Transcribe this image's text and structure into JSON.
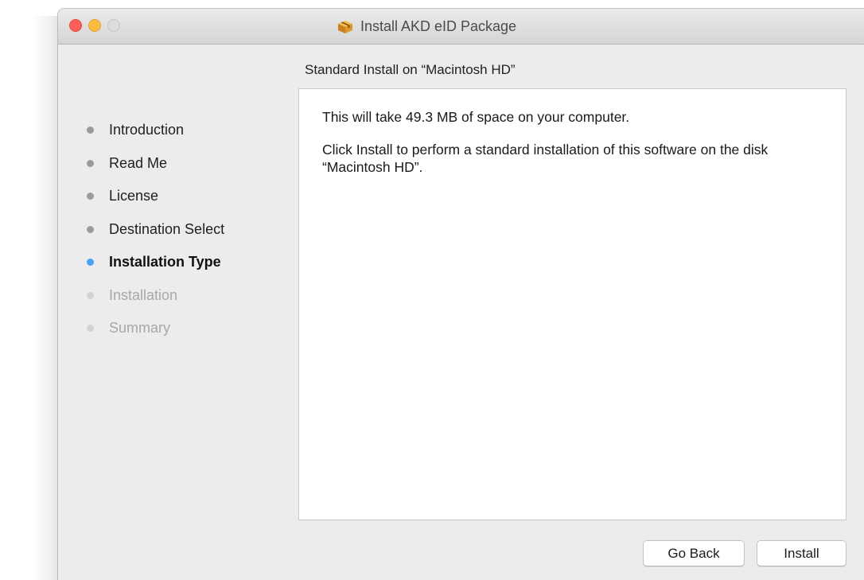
{
  "window": {
    "title": "Install AKD eID Package",
    "icon": "package-icon",
    "traffic_lights": {
      "close_color": "#fc605c",
      "minimize_color": "#fdbc40",
      "zoom_color": "#dcdcdc"
    }
  },
  "section_header": "Standard Install on “Macintosh HD”",
  "sidebar": {
    "active_color": "#4a9ef5",
    "steps": [
      {
        "label": "Introduction",
        "state": "done"
      },
      {
        "label": "Read Me",
        "state": "done"
      },
      {
        "label": "License",
        "state": "done"
      },
      {
        "label": "Destination Select",
        "state": "done"
      },
      {
        "label": "Installation Type",
        "state": "active"
      },
      {
        "label": "Installation",
        "state": "pending"
      },
      {
        "label": "Summary",
        "state": "pending"
      }
    ]
  },
  "content": {
    "paragraph_1": "This will take 49.3 MB of space on your computer.",
    "paragraph_2": "Click Install to perform a standard installation of this software on the disk “Macintosh HD”."
  },
  "buttons": {
    "back_label": "Go Back",
    "install_label": "Install"
  }
}
